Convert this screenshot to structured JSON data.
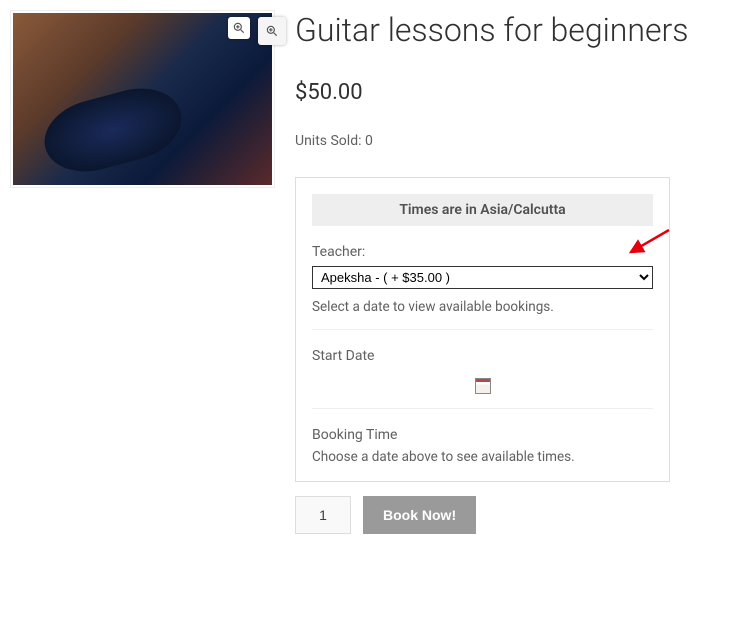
{
  "product": {
    "title": "Guitar lessons for beginners",
    "price": "$50.00",
    "units_sold": "Units Sold: 0"
  },
  "booking": {
    "tz_notice": "Times are in Asia/Calcutta",
    "teacher_label": "Teacher:",
    "teacher_selected": "Apeksha - ( + $35.00 )",
    "date_hint": "Select a date to view available bookings.",
    "start_date_label": "Start Date",
    "booking_time_label": "Booking Time",
    "booking_time_hint": "Choose a date above to see available times."
  },
  "actions": {
    "qty": "1",
    "book_button": "Book Now!"
  }
}
